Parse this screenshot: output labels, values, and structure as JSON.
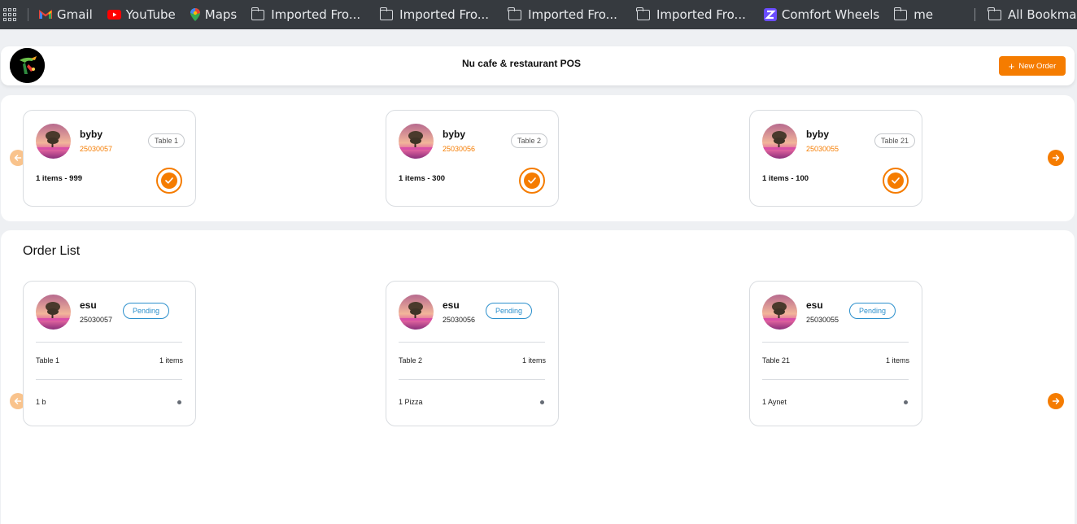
{
  "bookmarks": {
    "items": [
      {
        "label": "Gmail",
        "icon": "gmail-icon"
      },
      {
        "label": "YouTube",
        "icon": "youtube-icon"
      },
      {
        "label": "Maps",
        "icon": "maps-icon"
      },
      {
        "label": "Imported Fro...",
        "icon": "folder-icon"
      },
      {
        "label": "Imported Fro...",
        "icon": "folder-icon"
      },
      {
        "label": "Imported Fro...",
        "icon": "folder-icon"
      },
      {
        "label": "Imported Fro...",
        "icon": "folder-icon"
      },
      {
        "label": "Comfort Wheels",
        "icon": "comfort-wheels-icon"
      },
      {
        "label": "me",
        "icon": "folder-icon"
      }
    ],
    "all_bookmarks": "All Bookmarks"
  },
  "header": {
    "title": "Nu cafe & restaurant POS",
    "new_order_label": "New Order"
  },
  "top_orders": [
    {
      "name": "byby",
      "id": "25030057",
      "table": "Table 1",
      "summary": "1 items - 999"
    },
    {
      "name": "byby",
      "id": "25030056",
      "table": "Table 2",
      "summary": "1 items - 300"
    },
    {
      "name": "byby",
      "id": "25030055",
      "table": "Table 21",
      "summary": "1 items - 100"
    }
  ],
  "order_list": {
    "heading": "Order List",
    "orders": [
      {
        "name": "esu",
        "id": "25030057",
        "status": "Pending",
        "table": "Table 1",
        "count": "1 items",
        "item": "1 b"
      },
      {
        "name": "esu",
        "id": "25030056",
        "status": "Pending",
        "table": "Table 2",
        "count": "1 items",
        "item": "1 Pizza"
      },
      {
        "name": "esu",
        "id": "25030055",
        "status": "Pending",
        "table": "Table 21",
        "count": "1 items",
        "item": "1 Aynet"
      }
    ]
  },
  "colors": {
    "accent": "#f57c00",
    "accent_light": "#f9c38c",
    "status_pending": "#2b8fcc",
    "bookmarks_bg": "#363a3f"
  }
}
